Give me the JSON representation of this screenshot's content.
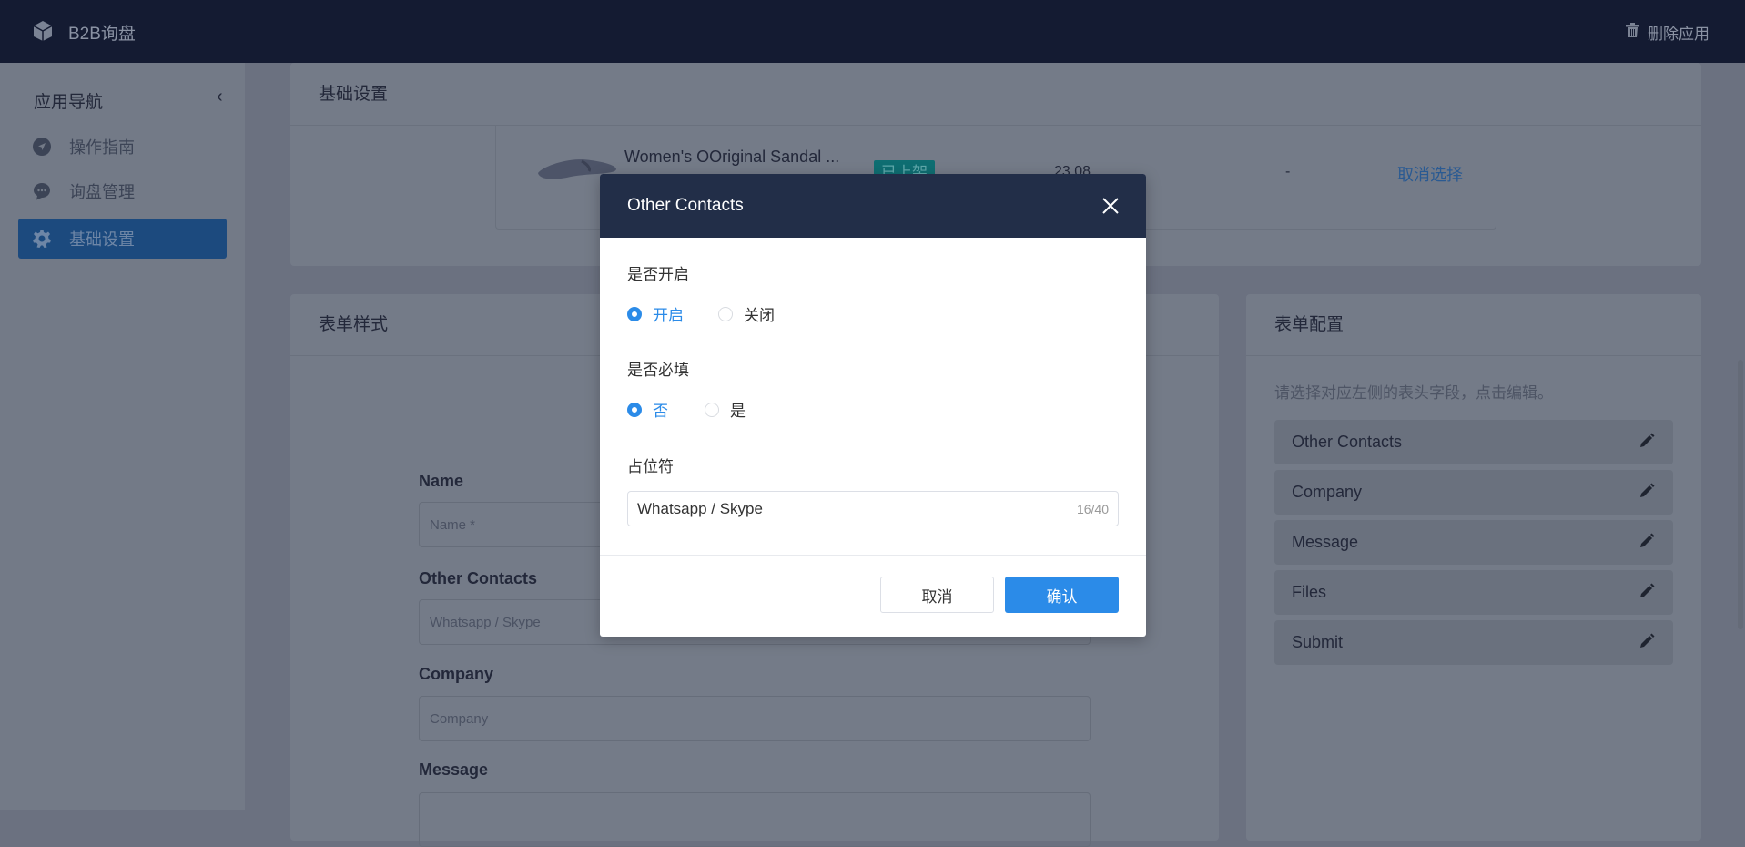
{
  "topbar": {
    "app_name": "B2B询盘",
    "delete_label": "删除应用"
  },
  "sidebar": {
    "title": "应用导航",
    "items": [
      {
        "label": "操作指南",
        "icon": "navigation-icon"
      },
      {
        "label": "询盘管理",
        "icon": "chat-icon"
      },
      {
        "label": "基础设置",
        "icon": "gear-icon",
        "active": true
      }
    ]
  },
  "basic_settings": {
    "title": "基础设置",
    "product": {
      "name": "Women's OOriginal Sandal ...",
      "status": "已上架",
      "price": "23.08",
      "extra": "-",
      "action": "取消选择"
    }
  },
  "form_style": {
    "title": "表单样式",
    "fields": [
      {
        "label": "Name",
        "placeholder": "Name *"
      },
      {
        "label": "Other Contacts",
        "placeholder": "Whatsapp / Skype"
      },
      {
        "label": "Company",
        "placeholder": "Company"
      },
      {
        "label": "Message",
        "placeholder": ""
      }
    ]
  },
  "form_config": {
    "title": "表单配置",
    "hint": "请选择对应左侧的表头字段，点击编辑。",
    "items": [
      "Other Contacts",
      "Company",
      "Message",
      "Files",
      "Submit"
    ]
  },
  "dialog": {
    "title": "Other Contacts",
    "enable": {
      "label": "是否开启",
      "options": [
        "开启",
        "关闭"
      ],
      "selected": "开启"
    },
    "required": {
      "label": "是否必填",
      "options": [
        "否",
        "是"
      ],
      "selected": "否"
    },
    "placeholder": {
      "label": "占位符",
      "value": "Whatsapp / Skype",
      "count": "16/40"
    },
    "cancel": "取消",
    "confirm": "确认"
  },
  "colors": {
    "primary": "#2b8be8",
    "dialog_header": "#222e48",
    "topbar": "#141b32",
    "status_tag": "#0f6e72"
  }
}
